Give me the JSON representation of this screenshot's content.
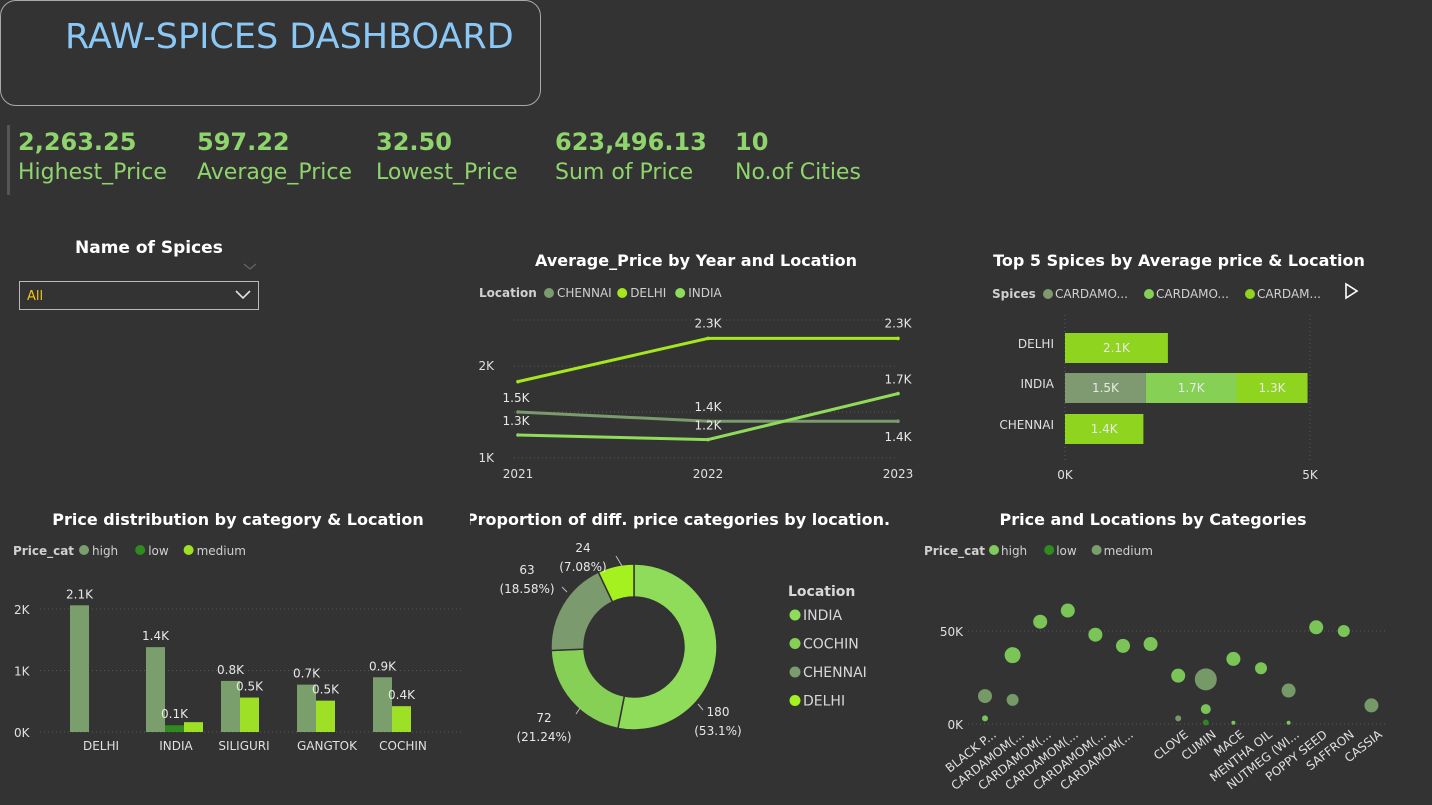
{
  "header": {
    "title": "RAW-SPICES DASHBOARD"
  },
  "kpis": [
    {
      "value": "2,263.25",
      "label": "Highest_Price"
    },
    {
      "value": "597.22",
      "label": "Average_Price"
    },
    {
      "value": "32.50",
      "label": "Lowest_Price"
    },
    {
      "value": "623,496.13",
      "label": "Sum of Price"
    },
    {
      "value": "10",
      "label": "No.of Cities"
    }
  ],
  "slicer": {
    "title": "Name of Spices",
    "value": "All"
  },
  "colors": {
    "bg": "#333333",
    "kpi": "#8fd46c",
    "title": "#8cc8f5",
    "chennai": "#7b9a6e",
    "delhi": "#a5e61f",
    "india": "#8fdc5a",
    "cochin": "#85d055",
    "high": "#7a9f6c",
    "low": "#2f8a1f",
    "medium": "#9ee025"
  },
  "chart_data": [
    {
      "type": "line",
      "title": "Average_Price by Year and Location",
      "legend_title": "Location",
      "x": [
        "2021",
        "2022",
        "2023"
      ],
      "yticks": [
        "1K",
        "2K"
      ],
      "ylim": [
        1000,
        2500
      ],
      "series": [
        {
          "name": "CHENNAI",
          "values": [
            1500,
            1400,
            1400
          ],
          "labels": [
            "1.5K",
            "1.4K",
            "1.4K"
          ],
          "color": "#7b9a6e"
        },
        {
          "name": "DELHI",
          "values": [
            1830,
            2300,
            2300
          ],
          "labels": [
            "",
            "2.3K",
            "2.3K"
          ],
          "color": "#a5e61f"
        },
        {
          "name": "INDIA",
          "values": [
            1250,
            1200,
            1700
          ],
          "labels": [
            "1.3K",
            "1.2K",
            "1.7K"
          ],
          "color": "#8fdc5a"
        }
      ]
    },
    {
      "type": "bar",
      "orientation": "horizontal-stacked",
      "title": "Top 5 Spices by Average price & Location",
      "legend_title": "Spices",
      "legend": [
        "CARDAMO...",
        "CARDAMO...",
        "CARDAM..."
      ],
      "categories": [
        "DELHI",
        "INDIA",
        "CHENNAI"
      ],
      "xticks": [
        "0K",
        "5K"
      ],
      "xlim": [
        0,
        5000
      ],
      "segments": [
        [
          {
            "value": 2100,
            "label": "2.1K",
            "color": "#8fd41e"
          }
        ],
        [
          {
            "value": 1650,
            "label": "1.5K",
            "color": "#7f9a70"
          },
          {
            "value": 1850,
            "label": "1.7K",
            "color": "#85d055"
          },
          {
            "value": 1450,
            "label": "1.3K",
            "color": "#8fd41e"
          }
        ],
        [
          {
            "value": 1600,
            "label": "1.4K",
            "color": "#8fd41e"
          }
        ]
      ]
    },
    {
      "type": "bar",
      "title": "Price distribution by category & Location",
      "legend_title": "Price_cat",
      "categories": [
        "DELHI",
        "INDIA",
        "SILIGURI",
        "GANGTOK",
        "COCHIN"
      ],
      "yticks": [
        "0K",
        "1K",
        "2K"
      ],
      "ylim": [
        0,
        2300
      ],
      "series": [
        {
          "name": "high",
          "values": [
            2060,
            1380,
            830,
            770,
            890
          ],
          "labels": [
            "2.1K",
            "1.4K",
            "0.8K",
            "0.7K",
            "0.9K"
          ],
          "color": "#7a9f6c"
        },
        {
          "name": "low",
          "values": [
            null,
            110,
            null,
            null,
            null
          ],
          "labels": [
            "",
            "0.1K",
            "",
            "",
            ""
          ],
          "color": "#2f8a1f"
        },
        {
          "name": "medium",
          "values": [
            null,
            160,
            560,
            510,
            420
          ],
          "labels": [
            "",
            "",
            "0.5K",
            "0.5K",
            "0.4K"
          ],
          "color": "#9ee025"
        }
      ]
    },
    {
      "type": "pie",
      "title": "Proportion of diff. price categories by location.",
      "legend_title": "Location",
      "slices": [
        {
          "name": "INDIA",
          "value": 180,
          "label": "180",
          "pct": "(53.1%)",
          "color": "#8fdc5a"
        },
        {
          "name": "COCHIN",
          "value": 72,
          "label": "72",
          "pct": "(21.24%)",
          "color": "#85d055"
        },
        {
          "name": "CHENNAI",
          "value": 63,
          "label": "63",
          "pct": "(18.58%)",
          "color": "#7b9a6e"
        },
        {
          "name": "DELHI",
          "value": 24,
          "label": "24",
          "pct": "(7.08%)",
          "color": "#a5f01f"
        }
      ]
    },
    {
      "type": "scatter",
      "title": "Price and Locations by Categories",
      "legend_title": "Price_cat",
      "legend": [
        {
          "name": "high",
          "color": "#7fcc5a"
        },
        {
          "name": "low",
          "color": "#2f8a1f"
        },
        {
          "name": "medium",
          "color": "#7a9f6c"
        }
      ],
      "categories": [
        "BLACK P...",
        "CARDAMOM(...",
        "CARDAMOM(...",
        "CARDAMOM(...",
        "CARDAMOM(...",
        "CARDAMOM(...",
        "CLOVE",
        "CUMIN",
        "MACE",
        "MENTHA OIL",
        "NUTMEG (WI...",
        "POPPY SEED",
        "SAFFRON",
        "CASSIA"
      ],
      "yticks": [
        "0K",
        "50K"
      ],
      "ylim": [
        0,
        65000
      ],
      "points": [
        {
          "x": 0,
          "y": 15000,
          "size": 7,
          "cat": "medium"
        },
        {
          "x": 0,
          "y": 3000,
          "size": 3,
          "cat": "high"
        },
        {
          "x": 1,
          "y": 37000,
          "size": 8,
          "cat": "high"
        },
        {
          "x": 1,
          "y": 13000,
          "size": 6,
          "cat": "medium"
        },
        {
          "x": 2,
          "y": 55000,
          "size": 7,
          "cat": "high"
        },
        {
          "x": 3,
          "y": 61000,
          "size": 7,
          "cat": "high"
        },
        {
          "x": 4,
          "y": 48000,
          "size": 7,
          "cat": "high"
        },
        {
          "x": 5,
          "y": 42000,
          "size": 7,
          "cat": "high"
        },
        {
          "x": 6,
          "y": 43000,
          "size": 7,
          "cat": "high"
        },
        {
          "x": 7,
          "y": 26000,
          "size": 7,
          "cat": "high"
        },
        {
          "x": 7,
          "y": 3000,
          "size": 3,
          "cat": "medium"
        },
        {
          "x": 8,
          "y": 24000,
          "size": 11,
          "cat": "medium"
        },
        {
          "x": 8,
          "y": 8000,
          "size": 5,
          "cat": "high"
        },
        {
          "x": 8,
          "y": 800,
          "size": 3,
          "cat": "low"
        },
        {
          "x": 9,
          "y": 35000,
          "size": 7,
          "cat": "high"
        },
        {
          "x": 9,
          "y": 700,
          "size": 2,
          "cat": "high"
        },
        {
          "x": 10,
          "y": 30000,
          "size": 6,
          "cat": "high"
        },
        {
          "x": 11,
          "y": 18000,
          "size": 7,
          "cat": "medium"
        },
        {
          "x": 11,
          "y": 700,
          "size": 2,
          "cat": "high"
        },
        {
          "x": 12,
          "y": 52000,
          "size": 7,
          "cat": "high"
        },
        {
          "x": 13,
          "y": 50000,
          "size": 6,
          "cat": "high"
        },
        {
          "x": 14,
          "y": 10000,
          "size": 7,
          "cat": "medium"
        }
      ]
    }
  ]
}
